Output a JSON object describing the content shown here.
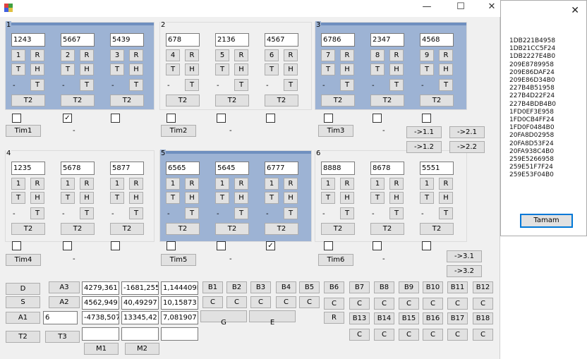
{
  "window": {
    "minimize": "—",
    "maximize": "☐",
    "close": "✕"
  },
  "panels": [
    {
      "num": "1",
      "vals": [
        "1243",
        "5667",
        "5439"
      ],
      "nums": [
        "1",
        "2",
        "3"
      ]
    },
    {
      "num": "2",
      "vals": [
        "678",
        "2136",
        "4567"
      ],
      "nums": [
        "4",
        "5",
        "6"
      ]
    },
    {
      "num": "3",
      "vals": [
        "6786",
        "2347",
        "4568"
      ],
      "nums": [
        "7",
        "8",
        "9"
      ]
    },
    {
      "num": "4",
      "vals": [
        "1235",
        "5678",
        "5877"
      ],
      "nums": [
        "1",
        "1",
        "1"
      ]
    },
    {
      "num": "5",
      "vals": [
        "6565",
        "5645",
        "6777"
      ],
      "nums": [
        "1",
        "1",
        "1"
      ]
    },
    {
      "num": "6",
      "vals": [
        "8888",
        "8678",
        "5551"
      ],
      "nums": [
        "1",
        "1",
        "1"
      ]
    }
  ],
  "labels": {
    "r": "R",
    "t": "T",
    "h": "H",
    "t2": "T2",
    "dash": "-"
  },
  "checks": {
    "row1": [
      "",
      "✓",
      "",
      "",
      "",
      "",
      "",
      "",
      ""
    ],
    "row2": [
      "",
      "",
      "",
      "",
      "",
      "✓",
      "",
      "",
      ""
    ]
  },
  "tims": [
    "Tim1",
    "Tim2",
    "Tim3",
    "Tim4",
    "Tim5",
    "Tim6"
  ],
  "arrows": [
    "->1.1",
    "->2.1",
    "->1.2",
    "->2.2",
    "->3.1",
    "->3.2"
  ],
  "bottom": {
    "d": "D",
    "s": "S",
    "a1": "A1",
    "a1val": "6",
    "t2": "T2",
    "t3": "T3",
    "a3": "A3",
    "a2": "A2",
    "m1": "M1",
    "m2": "M2",
    "grid": [
      [
        "4279,361",
        "-1681,255",
        "1,144409E"
      ],
      [
        "4562,949",
        "40,49297",
        "10,15873"
      ],
      [
        "-4738,507",
        "13345,42",
        "7,081907"
      ]
    ],
    "brow1": [
      "B1",
      "B2",
      "B3",
      "B4",
      "B5",
      "B6",
      "B7",
      "B8",
      "B9",
      "B10",
      "B11",
      "B12"
    ],
    "brow3": [
      "B13",
      "B14",
      "B15",
      "B16",
      "B17",
      "B18"
    ],
    "c": "C",
    "g": "G",
    "e": "E",
    "r": "R"
  },
  "dialog": {
    "close": "✕",
    "ok": "Tamam",
    "items": [
      "1DB221B4958",
      "1DB21CC5F24",
      "1DB2227E4B0",
      "209E8789958",
      "209E86DAF24",
      "209E86D34B0",
      "227B4B51958",
      "227B4D22F24",
      "227B4BDB4B0",
      "1FD0EF3E958",
      "1FD0CB4FF24",
      "1FD0F0484B0",
      "20FA8D02958",
      "20FA8D53F24",
      "20FA938C4B0",
      "259E5266958",
      "259E51F7F24",
      "259E53F04B0"
    ]
  }
}
